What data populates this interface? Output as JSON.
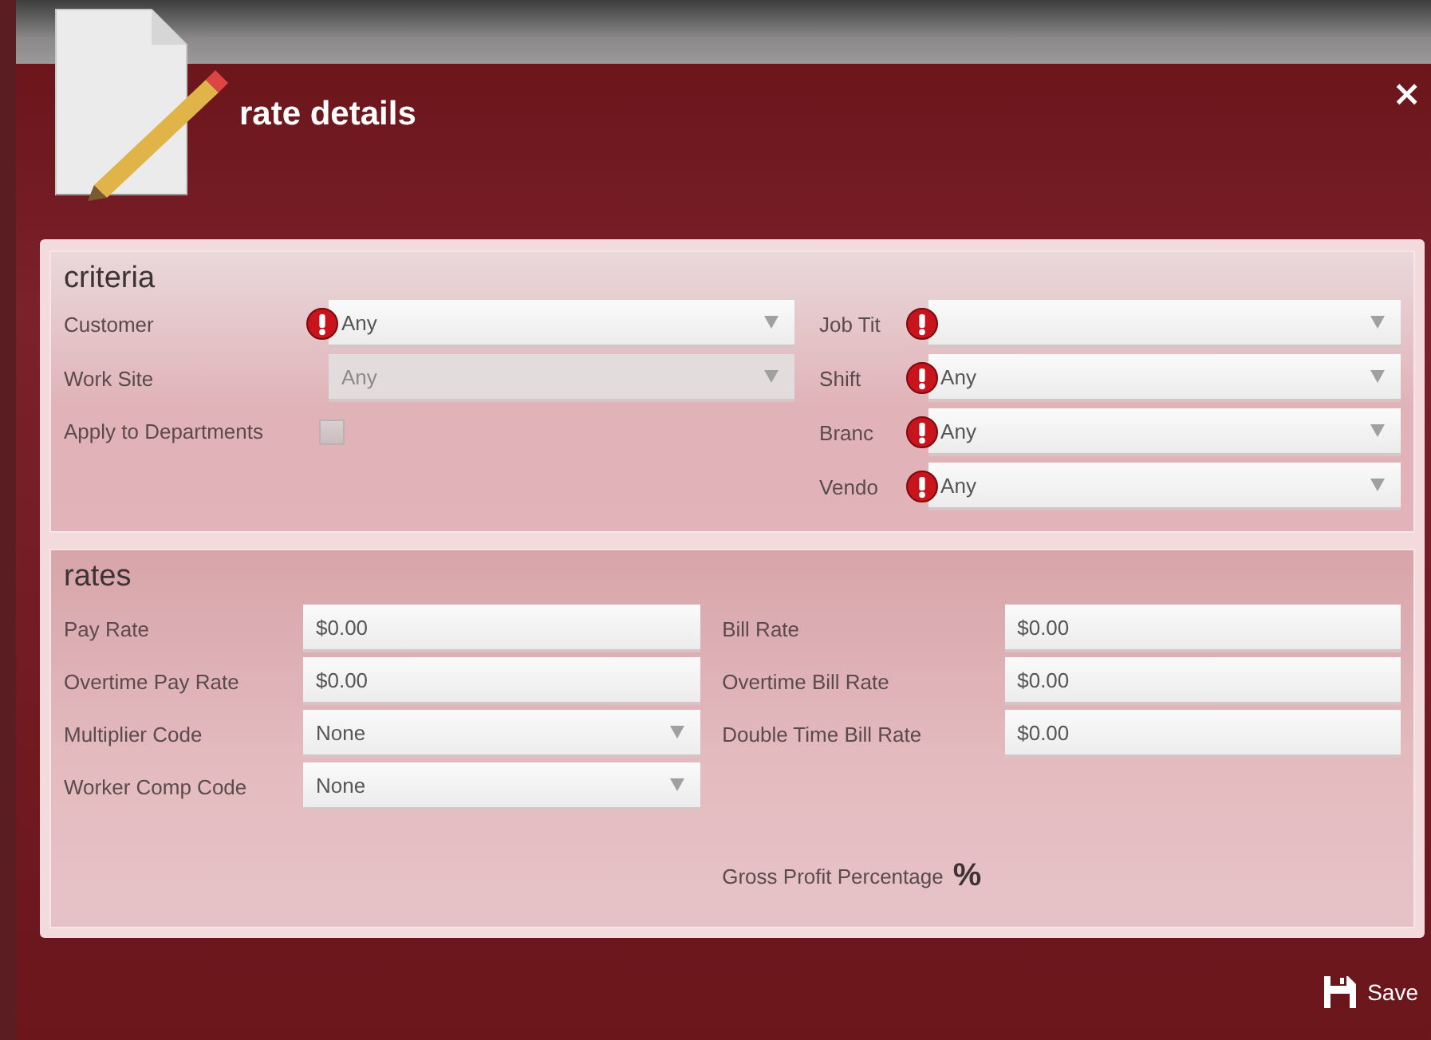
{
  "window": {
    "title": "rate details",
    "close": "×"
  },
  "criteria": {
    "title": "criteria",
    "left": [
      {
        "kind": "select",
        "label": "Customer",
        "value": "Any",
        "error": true,
        "disabled": false
      },
      {
        "kind": "select",
        "label": "Work Site",
        "value": "Any",
        "error": false,
        "disabled": true
      },
      {
        "kind": "checkbox",
        "label": "Apply to Departments",
        "checked": false
      }
    ],
    "right": [
      {
        "kind": "select",
        "label": "Job Tit",
        "error": true,
        "disabled": false
      },
      {
        "kind": "select",
        "label": "Shift",
        "value": "Any",
        "error": true,
        "disabled": false
      },
      {
        "kind": "select",
        "label": "Branc",
        "value": "Any",
        "error": true,
        "disabled": false
      },
      {
        "kind": "select",
        "label": "Vendo",
        "value": "Any",
        "error": true,
        "disabled": false
      }
    ]
  },
  "rates": {
    "title": "rates",
    "left": [
      {
        "kind": "text",
        "label": "Pay Rate",
        "value": "$0.00"
      },
      {
        "kind": "text",
        "label": "Overtime Pay Rate",
        "value": "$0.00"
      },
      {
        "kind": "select",
        "label": "Multiplier Code",
        "value": "None"
      },
      {
        "kind": "select",
        "label": "Worker Comp Code",
        "value": "None"
      }
    ],
    "right": [
      {
        "kind": "text",
        "label": "Bill Rate",
        "value": "$0.00"
      },
      {
        "kind": "text",
        "label": "Overtime Bill Rate",
        "value": "$0.00"
      },
      {
        "kind": "text",
        "label": "Double Time Bill Rate",
        "value": "$0.00"
      }
    ],
    "gross_profit": {
      "label": "Gross Profit Percentage",
      "value": "%"
    }
  },
  "footer": {
    "save": "Save"
  }
}
